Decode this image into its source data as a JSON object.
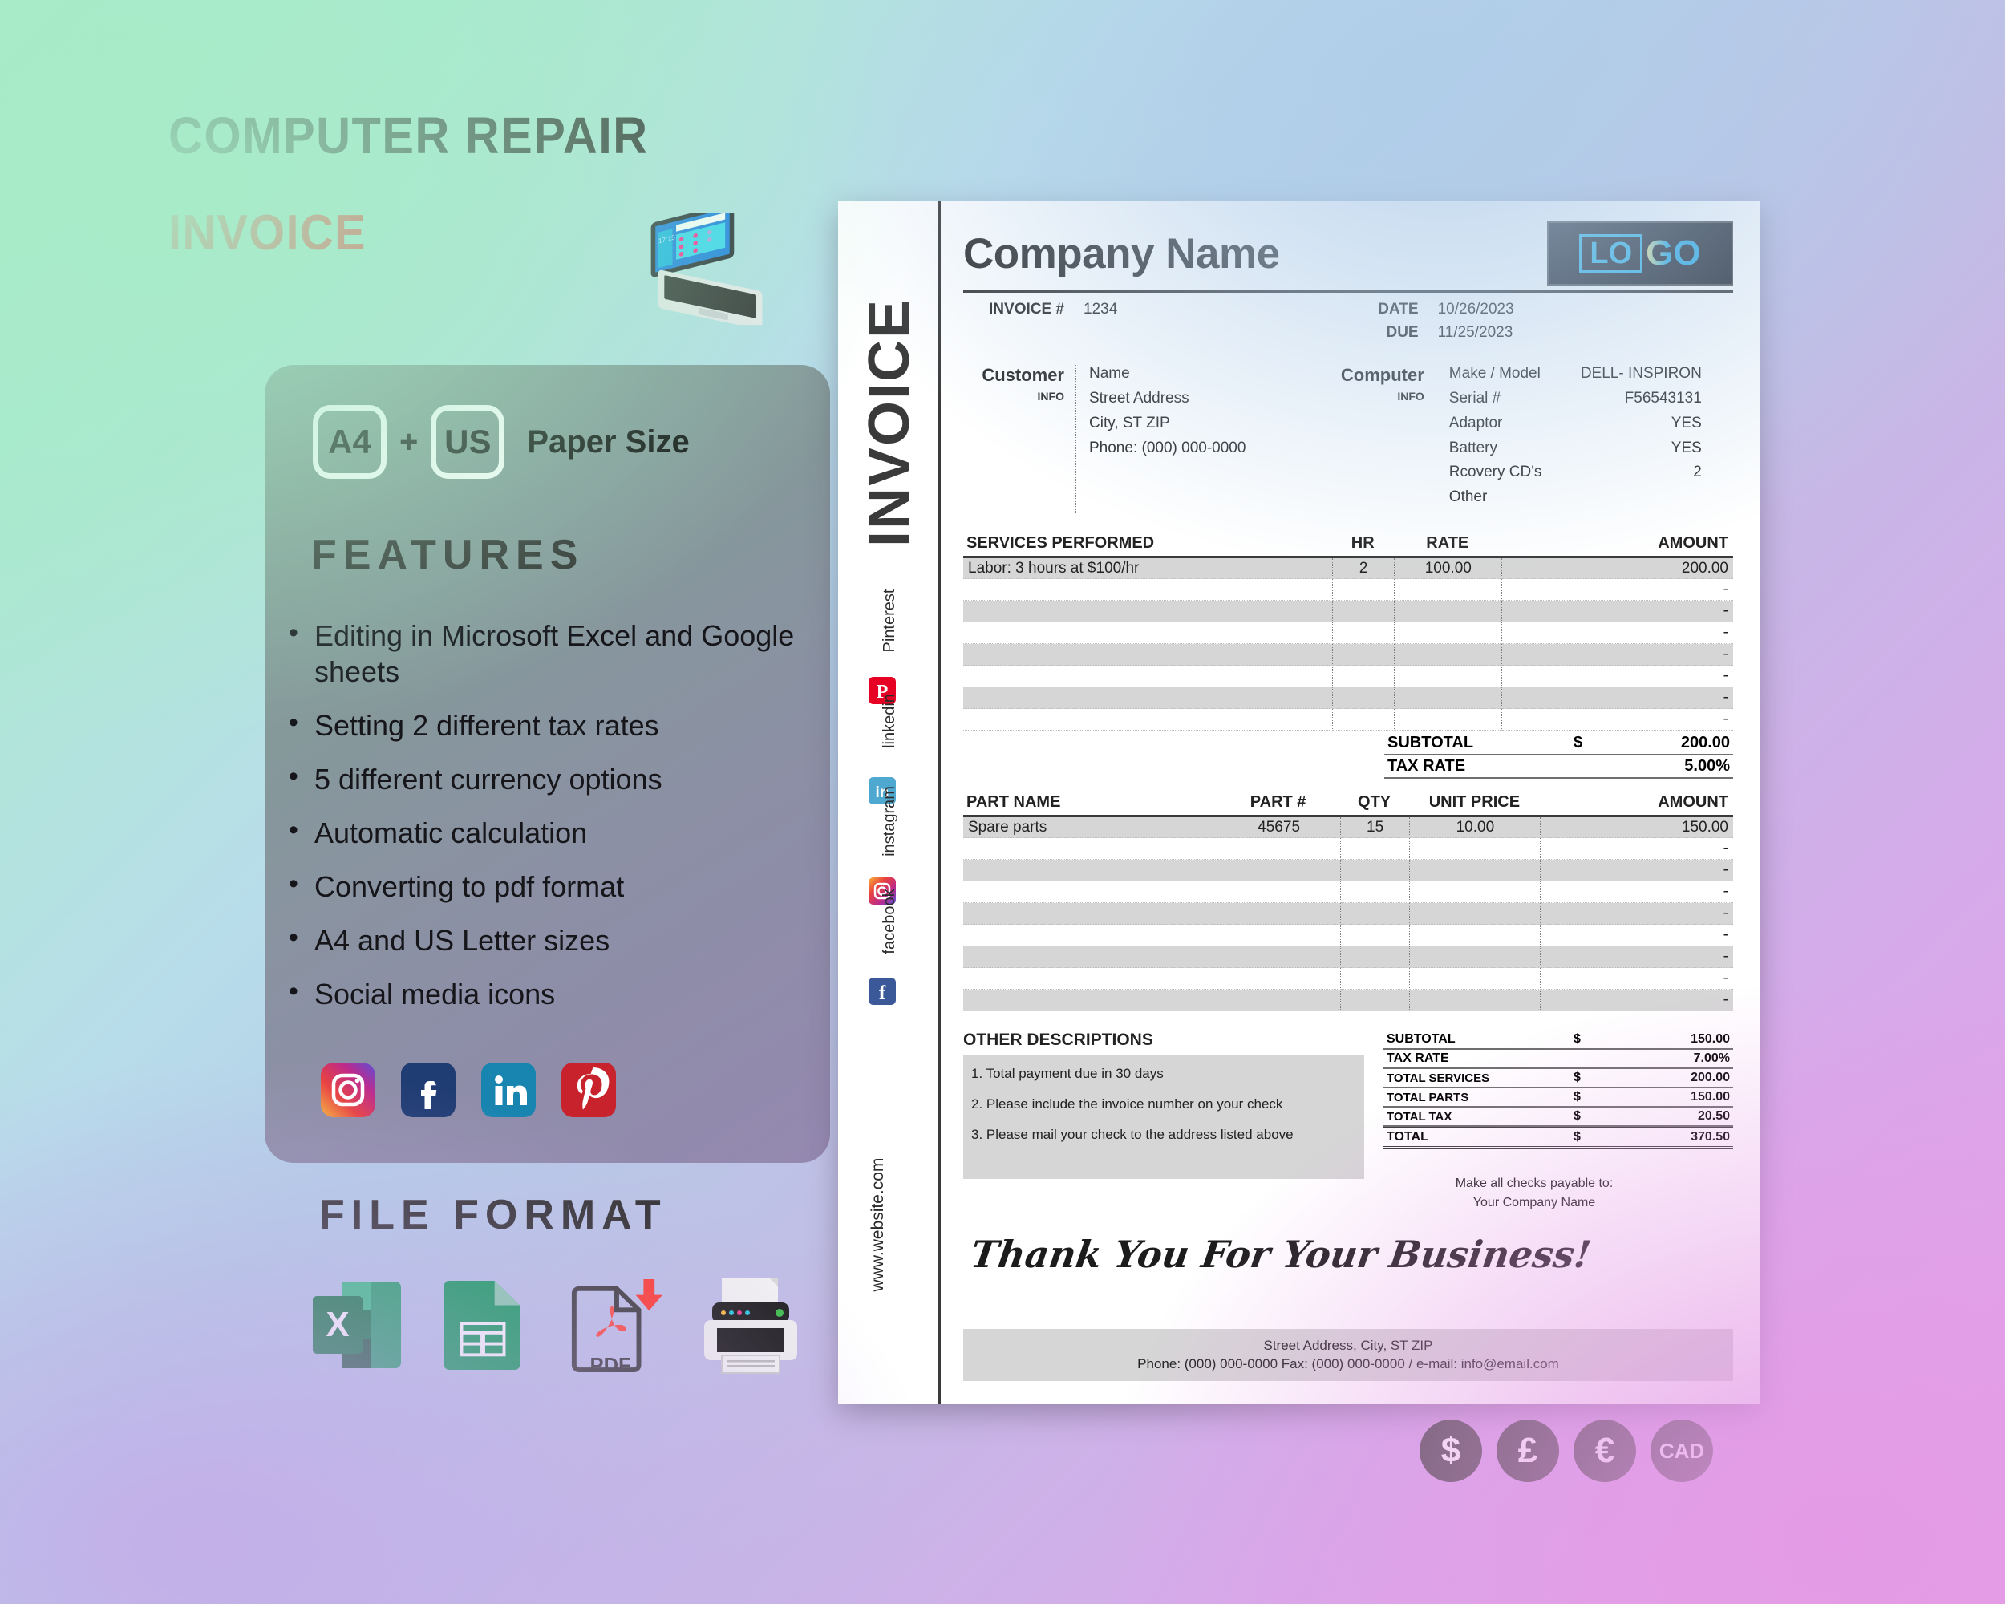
{
  "promo": {
    "title_line1": "COMPUTER REPAIR",
    "title_line2": "INVOICE",
    "paper": {
      "size_a4": "A4",
      "plus": "+",
      "size_us": "US",
      "label": "Paper Size"
    },
    "features_heading": "FEATURES",
    "features": [
      "Editing in Microsoft Excel and Google sheets",
      "Setting 2 different tax rates",
      "5 different currency options",
      "Automatic calculation",
      "Converting to pdf format",
      "A4 and US Letter sizes",
      "Social media icons"
    ],
    "social_icons": [
      "instagram-icon",
      "facebook-icon",
      "linkedin-icon",
      "pinterest-icon"
    ],
    "file_format_heading": "FILE FORMAT",
    "file_formats": [
      "excel-icon",
      "google-sheets-icon",
      "pdf-download-icon",
      "printer-icon"
    ],
    "currencies": [
      "$",
      "£",
      "€",
      "CAD"
    ],
    "colors": {
      "title_dark": "#333333",
      "title_red": "#f92f2f",
      "card_gray": "#7e968c",
      "currency_badge": "#4d4d4d"
    }
  },
  "invoice": {
    "rail_word": "INVOICE",
    "rail_social": [
      {
        "name": "Pinterest",
        "icon": "pinterest-icon",
        "color": "#e60023"
      },
      {
        "name": "linkedin",
        "icon": "linkedin-icon",
        "color": "#0e76a8"
      },
      {
        "name": "instagram",
        "icon": "instagram-icon",
        "color": "#c13584"
      },
      {
        "name": "facebook",
        "icon": "facebook-icon",
        "color": "#3b5998"
      }
    ],
    "rail_website": "www.website.com",
    "company_name": "Company Name",
    "logo": {
      "part1": "LO",
      "part2": "GO"
    },
    "meta": {
      "invoice_label": "INVOICE #",
      "invoice_value": "1234",
      "date_label": "DATE",
      "date_value": "10/26/2023",
      "due_label": "DUE",
      "due_value": "11/25/2023"
    },
    "customer": {
      "head_big": "Customer",
      "head_small": "INFO",
      "lines": [
        "Name",
        "Street Address",
        "City, ST ZIP",
        "Phone: (000) 000-0000"
      ]
    },
    "computer": {
      "head_big": "Computer",
      "head_small": "INFO",
      "rows": [
        {
          "k": "Make / Model",
          "v": "DELL- INSPIRON"
        },
        {
          "k": "Serial #",
          "v": "F56543131"
        },
        {
          "k": "Adaptor",
          "v": "YES"
        },
        {
          "k": "Battery",
          "v": "YES"
        },
        {
          "k": "Rcovery CD's",
          "v": "2"
        },
        {
          "k": "Other",
          "v": ""
        }
      ]
    },
    "services": {
      "headers": [
        "SERVICES PERFORMED",
        "HR",
        "RATE",
        "AMOUNT"
      ],
      "rows": [
        {
          "desc": "Labor: 3 hours at $100/hr",
          "hr": "2",
          "rate": "100.00",
          "amount": "200.00"
        },
        {
          "desc": "",
          "hr": "",
          "rate": "",
          "amount": "-"
        },
        {
          "desc": "",
          "hr": "",
          "rate": "",
          "amount": "-"
        },
        {
          "desc": "",
          "hr": "",
          "rate": "",
          "amount": "-"
        },
        {
          "desc": "",
          "hr": "",
          "rate": "",
          "amount": "-"
        },
        {
          "desc": "",
          "hr": "",
          "rate": "",
          "amount": "-"
        },
        {
          "desc": "",
          "hr": "",
          "rate": "",
          "amount": "-"
        },
        {
          "desc": "",
          "hr": "",
          "rate": "",
          "amount": "-"
        }
      ],
      "subtotal_label": "SUBTOTAL",
      "subtotal_currency": "$",
      "subtotal_value": "200.00",
      "taxrate_label": "TAX RATE",
      "taxrate_value": "5.00%"
    },
    "parts": {
      "headers": [
        "PART NAME",
        "PART #",
        "QTY",
        "UNIT PRICE",
        "AMOUNT"
      ],
      "rows": [
        {
          "name": "Spare parts",
          "num": "45675",
          "qty": "15",
          "unit": "10.00",
          "amount": "150.00"
        },
        {
          "name": "",
          "num": "",
          "qty": "",
          "unit": "",
          "amount": "-"
        },
        {
          "name": "",
          "num": "",
          "qty": "",
          "unit": "",
          "amount": "-"
        },
        {
          "name": "",
          "num": "",
          "qty": "",
          "unit": "",
          "amount": "-"
        },
        {
          "name": "",
          "num": "",
          "qty": "",
          "unit": "",
          "amount": "-"
        },
        {
          "name": "",
          "num": "",
          "qty": "",
          "unit": "",
          "amount": "-"
        },
        {
          "name": "",
          "num": "",
          "qty": "",
          "unit": "",
          "amount": "-"
        },
        {
          "name": "",
          "num": "",
          "qty": "",
          "unit": "",
          "amount": "-"
        },
        {
          "name": "",
          "num": "",
          "qty": "",
          "unit": "",
          "amount": "-"
        }
      ]
    },
    "other_descriptions": {
      "heading": "OTHER DESCRIPTIONS",
      "items": [
        "1. Total payment due in 30 days",
        "2. Please include the invoice number on your check",
        "3. Please mail your check to the address listed above"
      ]
    },
    "totals": [
      {
        "label": "SUBTOTAL",
        "currency": "$",
        "value": "150.00",
        "small": false
      },
      {
        "label": "TAX RATE",
        "currency": "",
        "value": "7.00%",
        "small": false
      },
      {
        "label": "TOTAL SERVICES",
        "currency": "$",
        "value": "200.00",
        "small": true
      },
      {
        "label": "TOTAL PARTS",
        "currency": "$",
        "value": "150.00",
        "small": true
      },
      {
        "label": "TOTAL TAX",
        "currency": "$",
        "value": "20.50",
        "small": true
      },
      {
        "label": "TOTAL",
        "currency": "$",
        "value": "370.50",
        "small": false
      }
    ],
    "payable": {
      "line1": "Make all checks payable to:",
      "line2": "Your Company Name"
    },
    "thanks": "Thank You For Your Business!",
    "footer": {
      "line1": "Street Address, City, ST ZIP",
      "line2": "Phone: (000) 000-0000   Fax: (000) 000-0000 / e-mail: info@email.com"
    }
  }
}
